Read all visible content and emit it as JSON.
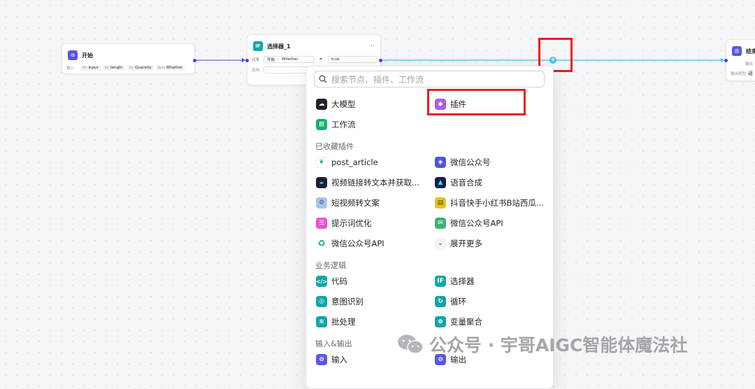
{
  "start_node": {
    "title": "开始",
    "input_label": "输入",
    "params": [
      {
        "type": "Str",
        "name": "input"
      },
      {
        "type": "Str",
        "name": "length"
      },
      {
        "type": "Str",
        "name": "Quantity"
      },
      {
        "type": "Bool",
        "name": "Whether"
      }
    ]
  },
  "selector_node": {
    "title": "选择器_1",
    "more": "···",
    "if_label": "如果",
    "cond_source": "开始",
    "cond_sep": "-",
    "cond_var": "Whether",
    "cond_op": "=",
    "cond_value": "true",
    "else_label": "否则"
  },
  "end_node": {
    "title": "结束",
    "output_label": "输出",
    "output_type_label": "输出类型",
    "output_type_value": "返"
  },
  "popup": {
    "search_placeholder": "搜索节点、插件、工作流",
    "top_items": [
      {
        "label": "大模型",
        "icon": "llm-icon",
        "color": "#1f2329"
      },
      {
        "label": "插件",
        "icon": "plugin-icon",
        "color": "#b05be8"
      },
      {
        "label": "工作流",
        "icon": "workflow-icon",
        "color": "#17b06a"
      }
    ],
    "favorites_title": "已收藏插件",
    "favorites": [
      {
        "label": "post_article",
        "icon": "leaf-icon",
        "color": "#ffffff"
      },
      {
        "label": "微信公众号",
        "icon": "wechat-mp-icon",
        "color": "#4e55e0"
      },
      {
        "label": "视频链接转文本并获取...",
        "icon": "video-text-icon",
        "color": "#1a2233"
      },
      {
        "label": "语音合成",
        "icon": "voice-synthesis-icon",
        "color": "#13204a"
      },
      {
        "label": "短视频转文案",
        "icon": "short-video-icon",
        "color": "#a9c4e6"
      },
      {
        "label": "抖音快手小红书B站西瓜...",
        "icon": "multi-platform-icon",
        "color": "#e8c21a"
      },
      {
        "label": "提示词优化",
        "icon": "prompt-optimize-icon",
        "color": "#f04fd0"
      },
      {
        "label": "微信公众号API",
        "icon": "wechat-api-icon",
        "color": "#3bb573"
      },
      {
        "label": "微信公众号API",
        "icon": "recycle-icon",
        "color": "#ffffff"
      },
      {
        "label": "展开更多",
        "icon": "chevron-down-icon",
        "color": "#f2f3f5"
      }
    ],
    "logic_title": "业务逻辑",
    "logic": [
      {
        "label": "代码",
        "icon": "code-icon",
        "color": "#12a6a6"
      },
      {
        "label": "选择器",
        "icon": "if-icon",
        "color": "#12a6a6"
      },
      {
        "label": "意图识别",
        "icon": "intent-icon",
        "color": "#12a6a6"
      },
      {
        "label": "循环",
        "icon": "loop-icon",
        "color": "#12a6a6"
      },
      {
        "label": "批处理",
        "icon": "batch-icon",
        "color": "#12a6a6"
      },
      {
        "label": "变量聚合",
        "icon": "variable-merge-icon",
        "color": "#12a6a6"
      }
    ],
    "io_title": "输入&输出",
    "io": [
      {
        "label": "输入",
        "icon": "input-icon",
        "color": "#5a56e8"
      },
      {
        "label": "输出",
        "icon": "output-icon",
        "color": "#5a56e8"
      }
    ]
  },
  "watermark": {
    "text": "公众号 · 宇哥AIGC智能体魔法社"
  },
  "colors": {
    "accent": "#4e40e5",
    "connector": "#3dc4ee",
    "highlight": "#ef1b1b"
  }
}
